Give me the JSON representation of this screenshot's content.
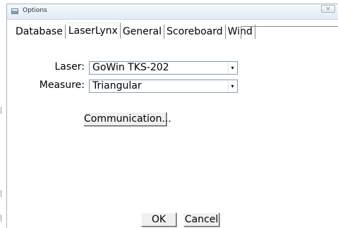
{
  "window": {
    "title": "Options",
    "close_glyph": "✕"
  },
  "tabs": [
    {
      "label": "Database",
      "active": false
    },
    {
      "label": "LaserLynx",
      "active": true
    },
    {
      "label": "General",
      "active": false
    },
    {
      "label": "Scoreboard",
      "active": false
    },
    {
      "label": "Wind",
      "active": false
    }
  ],
  "form": {
    "laser_label": "Laser:",
    "laser_value": "GoWin TKS-202",
    "measure_label": "Measure:",
    "measure_value": "Triangular",
    "dropdown_arrow": "▾"
  },
  "buttons": {
    "communication": "Communication...",
    "ok": "OK",
    "cancel": "Cancel"
  },
  "icons": {
    "app": "window-icon",
    "close": "close-icon",
    "dropdown": "chevron-down-icon"
  }
}
